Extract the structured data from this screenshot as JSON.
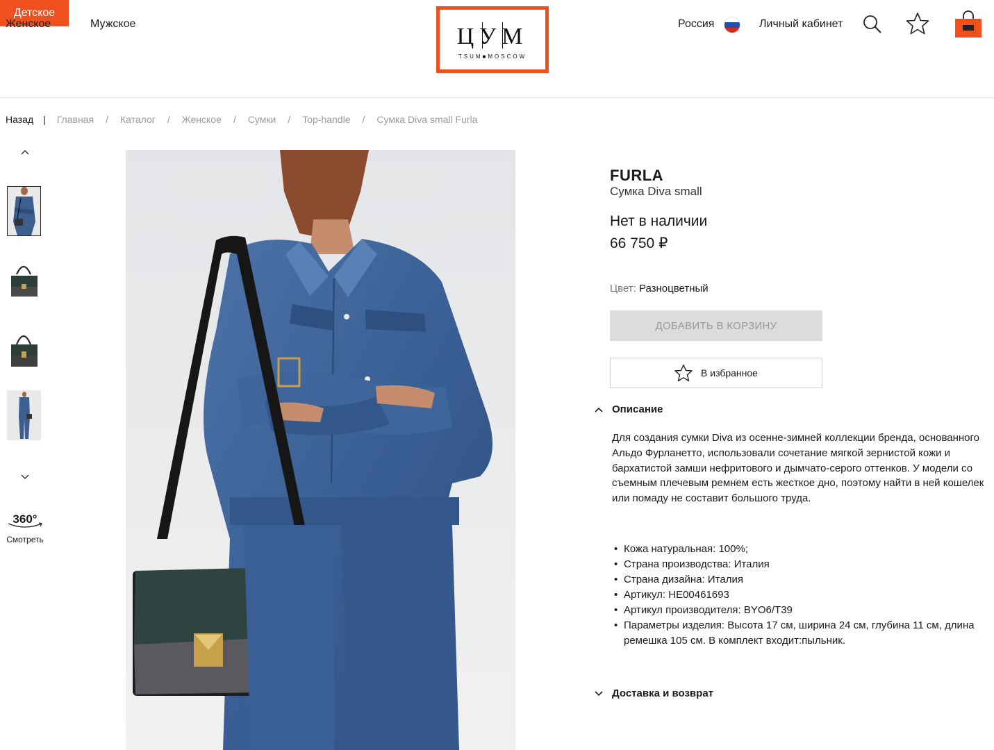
{
  "header": {
    "nav": [
      "Женское",
      "Мужское",
      "Детское"
    ],
    "logo_letters": "ЦУМ",
    "logo_sub": "TSUM■MOSCOW",
    "region": "Россия",
    "account": "Личный кабинет",
    "icons": {
      "search": "search-icon",
      "favorites": "star-icon",
      "cart": "shopping-bag-icon",
      "flag": "russia-flag-icon"
    }
  },
  "breadcrumb": {
    "back": "Назад",
    "bar": "|",
    "items": [
      "Главная",
      "Каталог",
      "Женское",
      "Сумки",
      "Top-handle",
      "Сумка Diva small Furla"
    ],
    "sep": "/"
  },
  "gallery": {
    "view360_num": "360°",
    "view360_label": "Смотреть"
  },
  "product": {
    "brand": "FURLA",
    "name": "Сумка Diva small",
    "availability": "Нет в наличии",
    "price": "66 750 ₽",
    "color_key": "Цвет:",
    "color_value": "Разноцветный",
    "add_to_cart": "ДОБАВИТЬ В КОРЗИНУ",
    "favorites": "В избранное"
  },
  "description": {
    "title": "Описание",
    "text": "Для создания сумки Diva из осенне-зимней коллекции бренда, основанного Альдо Фурланетто, использовали сочетание мягкой зернистой кожи и бархатистой замши нефритового и дымчато-серого оттенков. У модели со съемным плечевым ремнем есть жесткое дно, поэтому найти в ней кошелек или помаду не составит большого труда.",
    "specs": [
      "Кожа натуральная: 100%;",
      "Страна производства: Италия",
      "Страна дизайна: Италия",
      "Артикул: HE00461693",
      "Артикул производителя: BYO6/T39",
      "Параметры изделия: Высота 17 см, ширина 24 см, глубина 11 см, длина ремешка 105 см. В комплект входит:пыльник."
    ]
  },
  "delivery": {
    "title": "Доставка и возврат"
  },
  "colors": {
    "accent": "#f0501e",
    "disabled_bg": "#dcdcdc",
    "muted": "#9a9a9a"
  }
}
